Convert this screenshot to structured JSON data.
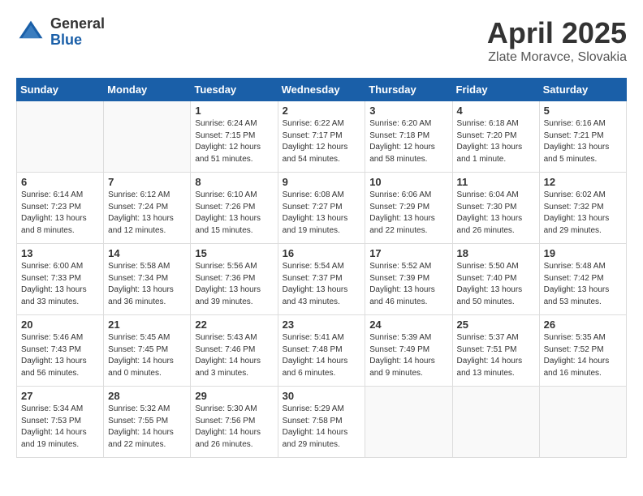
{
  "logo": {
    "general": "General",
    "blue": "Blue"
  },
  "title": {
    "month": "April 2025",
    "location": "Zlate Moravce, Slovakia"
  },
  "weekdays": [
    "Sunday",
    "Monday",
    "Tuesday",
    "Wednesday",
    "Thursday",
    "Friday",
    "Saturday"
  ],
  "weeks": [
    [
      {
        "day": "",
        "info": ""
      },
      {
        "day": "",
        "info": ""
      },
      {
        "day": "1",
        "info": "Sunrise: 6:24 AM\nSunset: 7:15 PM\nDaylight: 12 hours\nand 51 minutes."
      },
      {
        "day": "2",
        "info": "Sunrise: 6:22 AM\nSunset: 7:17 PM\nDaylight: 12 hours\nand 54 minutes."
      },
      {
        "day": "3",
        "info": "Sunrise: 6:20 AM\nSunset: 7:18 PM\nDaylight: 12 hours\nand 58 minutes."
      },
      {
        "day": "4",
        "info": "Sunrise: 6:18 AM\nSunset: 7:20 PM\nDaylight: 13 hours\nand 1 minute."
      },
      {
        "day": "5",
        "info": "Sunrise: 6:16 AM\nSunset: 7:21 PM\nDaylight: 13 hours\nand 5 minutes."
      }
    ],
    [
      {
        "day": "6",
        "info": "Sunrise: 6:14 AM\nSunset: 7:23 PM\nDaylight: 13 hours\nand 8 minutes."
      },
      {
        "day": "7",
        "info": "Sunrise: 6:12 AM\nSunset: 7:24 PM\nDaylight: 13 hours\nand 12 minutes."
      },
      {
        "day": "8",
        "info": "Sunrise: 6:10 AM\nSunset: 7:26 PM\nDaylight: 13 hours\nand 15 minutes."
      },
      {
        "day": "9",
        "info": "Sunrise: 6:08 AM\nSunset: 7:27 PM\nDaylight: 13 hours\nand 19 minutes."
      },
      {
        "day": "10",
        "info": "Sunrise: 6:06 AM\nSunset: 7:29 PM\nDaylight: 13 hours\nand 22 minutes."
      },
      {
        "day": "11",
        "info": "Sunrise: 6:04 AM\nSunset: 7:30 PM\nDaylight: 13 hours\nand 26 minutes."
      },
      {
        "day": "12",
        "info": "Sunrise: 6:02 AM\nSunset: 7:32 PM\nDaylight: 13 hours\nand 29 minutes."
      }
    ],
    [
      {
        "day": "13",
        "info": "Sunrise: 6:00 AM\nSunset: 7:33 PM\nDaylight: 13 hours\nand 33 minutes."
      },
      {
        "day": "14",
        "info": "Sunrise: 5:58 AM\nSunset: 7:34 PM\nDaylight: 13 hours\nand 36 minutes."
      },
      {
        "day": "15",
        "info": "Sunrise: 5:56 AM\nSunset: 7:36 PM\nDaylight: 13 hours\nand 39 minutes."
      },
      {
        "day": "16",
        "info": "Sunrise: 5:54 AM\nSunset: 7:37 PM\nDaylight: 13 hours\nand 43 minutes."
      },
      {
        "day": "17",
        "info": "Sunrise: 5:52 AM\nSunset: 7:39 PM\nDaylight: 13 hours\nand 46 minutes."
      },
      {
        "day": "18",
        "info": "Sunrise: 5:50 AM\nSunset: 7:40 PM\nDaylight: 13 hours\nand 50 minutes."
      },
      {
        "day": "19",
        "info": "Sunrise: 5:48 AM\nSunset: 7:42 PM\nDaylight: 13 hours\nand 53 minutes."
      }
    ],
    [
      {
        "day": "20",
        "info": "Sunrise: 5:46 AM\nSunset: 7:43 PM\nDaylight: 13 hours\nand 56 minutes."
      },
      {
        "day": "21",
        "info": "Sunrise: 5:45 AM\nSunset: 7:45 PM\nDaylight: 14 hours\nand 0 minutes."
      },
      {
        "day": "22",
        "info": "Sunrise: 5:43 AM\nSunset: 7:46 PM\nDaylight: 14 hours\nand 3 minutes."
      },
      {
        "day": "23",
        "info": "Sunrise: 5:41 AM\nSunset: 7:48 PM\nDaylight: 14 hours\nand 6 minutes."
      },
      {
        "day": "24",
        "info": "Sunrise: 5:39 AM\nSunset: 7:49 PM\nDaylight: 14 hours\nand 9 minutes."
      },
      {
        "day": "25",
        "info": "Sunrise: 5:37 AM\nSunset: 7:51 PM\nDaylight: 14 hours\nand 13 minutes."
      },
      {
        "day": "26",
        "info": "Sunrise: 5:35 AM\nSunset: 7:52 PM\nDaylight: 14 hours\nand 16 minutes."
      }
    ],
    [
      {
        "day": "27",
        "info": "Sunrise: 5:34 AM\nSunset: 7:53 PM\nDaylight: 14 hours\nand 19 minutes."
      },
      {
        "day": "28",
        "info": "Sunrise: 5:32 AM\nSunset: 7:55 PM\nDaylight: 14 hours\nand 22 minutes."
      },
      {
        "day": "29",
        "info": "Sunrise: 5:30 AM\nSunset: 7:56 PM\nDaylight: 14 hours\nand 26 minutes."
      },
      {
        "day": "30",
        "info": "Sunrise: 5:29 AM\nSunset: 7:58 PM\nDaylight: 14 hours\nand 29 minutes."
      },
      {
        "day": "",
        "info": ""
      },
      {
        "day": "",
        "info": ""
      },
      {
        "day": "",
        "info": ""
      }
    ]
  ]
}
